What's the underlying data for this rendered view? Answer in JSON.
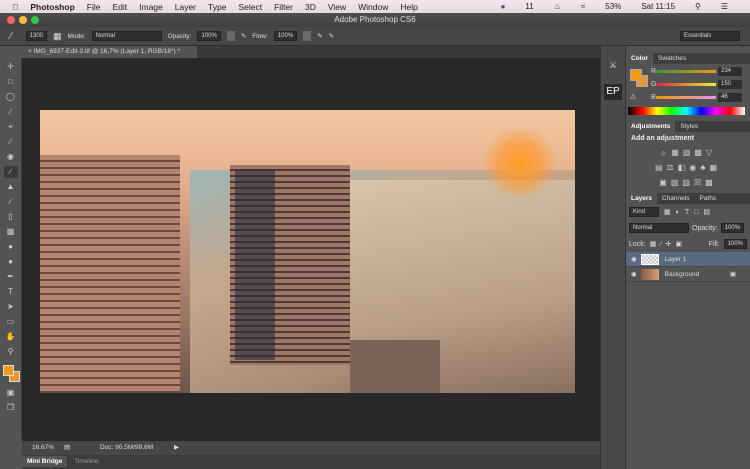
{
  "menubar": {
    "apple": "",
    "app": "Photoshop",
    "items": [
      "File",
      "Edit",
      "Image",
      "Layer",
      "Type",
      "Select",
      "Filter",
      "3D",
      "View",
      "Window",
      "Help"
    ],
    "status": {
      "notif": "11",
      "battery": "53%",
      "clock": "Sat 11:15"
    }
  },
  "window": {
    "title": "Adobe Photoshop CS6"
  },
  "options": {
    "brush_size": "1300",
    "mode_label": "Mode:",
    "mode": "Normal",
    "opacity_label": "Opacity:",
    "opacity": "100%",
    "flow_label": "Flow:",
    "flow": "100%",
    "workspace": "Essentials"
  },
  "document": {
    "tab": "IMG_6937-Edit-3.tif @ 16,7% (Layer 1, RGB/16*) *",
    "zoom": "16.67%",
    "doc_size": "Doc: 90,5M/99,6M"
  },
  "bottom_tabs": [
    "Mini Bridge",
    "Timeline"
  ],
  "dock": {
    "ep": "EP"
  },
  "color_panel": {
    "tabs": [
      "Color",
      "Swatches"
    ],
    "r_label": "R",
    "g_label": "G",
    "b_label": "B",
    "r": "234",
    "g": "150",
    "b": "46",
    "foreground": "#ea962e"
  },
  "adjustments": {
    "tabs": [
      "Adjustments",
      "Styles"
    ],
    "heading": "Add an adjustment"
  },
  "layers_panel": {
    "tabs": [
      "Layers",
      "Channels",
      "Paths"
    ],
    "filter": "Kind",
    "blend": "Normal",
    "opacity_label": "Opacity:",
    "opacity": "100%",
    "lock_label": "Lock:",
    "fill_label": "Fill:",
    "fill": "100%",
    "layers": [
      {
        "name": "Layer 1"
      },
      {
        "name": "Background"
      }
    ]
  }
}
